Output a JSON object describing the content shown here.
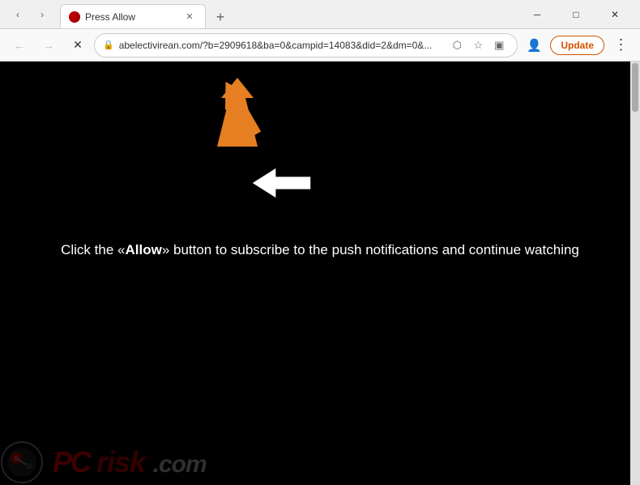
{
  "titlebar": {
    "tab_title": "Press Allow",
    "new_tab_label": "+",
    "chevron_down": "∨",
    "minimize": "─",
    "restore": "□",
    "close": "✕"
  },
  "addressbar": {
    "back_icon": "←",
    "forward_icon": "→",
    "reload_icon": "✕",
    "lock_icon": "🔒",
    "url": "abelectivirean.com/?b=2909618&ba=0&campid=14083&did=2&dm=0&...",
    "share_icon": "⬡",
    "star_icon": "☆",
    "sidebar_icon": "▣",
    "profile_icon": "👤",
    "update_label": "Update",
    "menu_icon": "⋮"
  },
  "content": {
    "main_text": "Click the «Allow» button to subscribe to the push notifications and continue watching",
    "bold_word": "Allow"
  },
  "watermark": {
    "text_pc": "PC",
    "text_risk": "risk",
    "text_com": ".com"
  }
}
